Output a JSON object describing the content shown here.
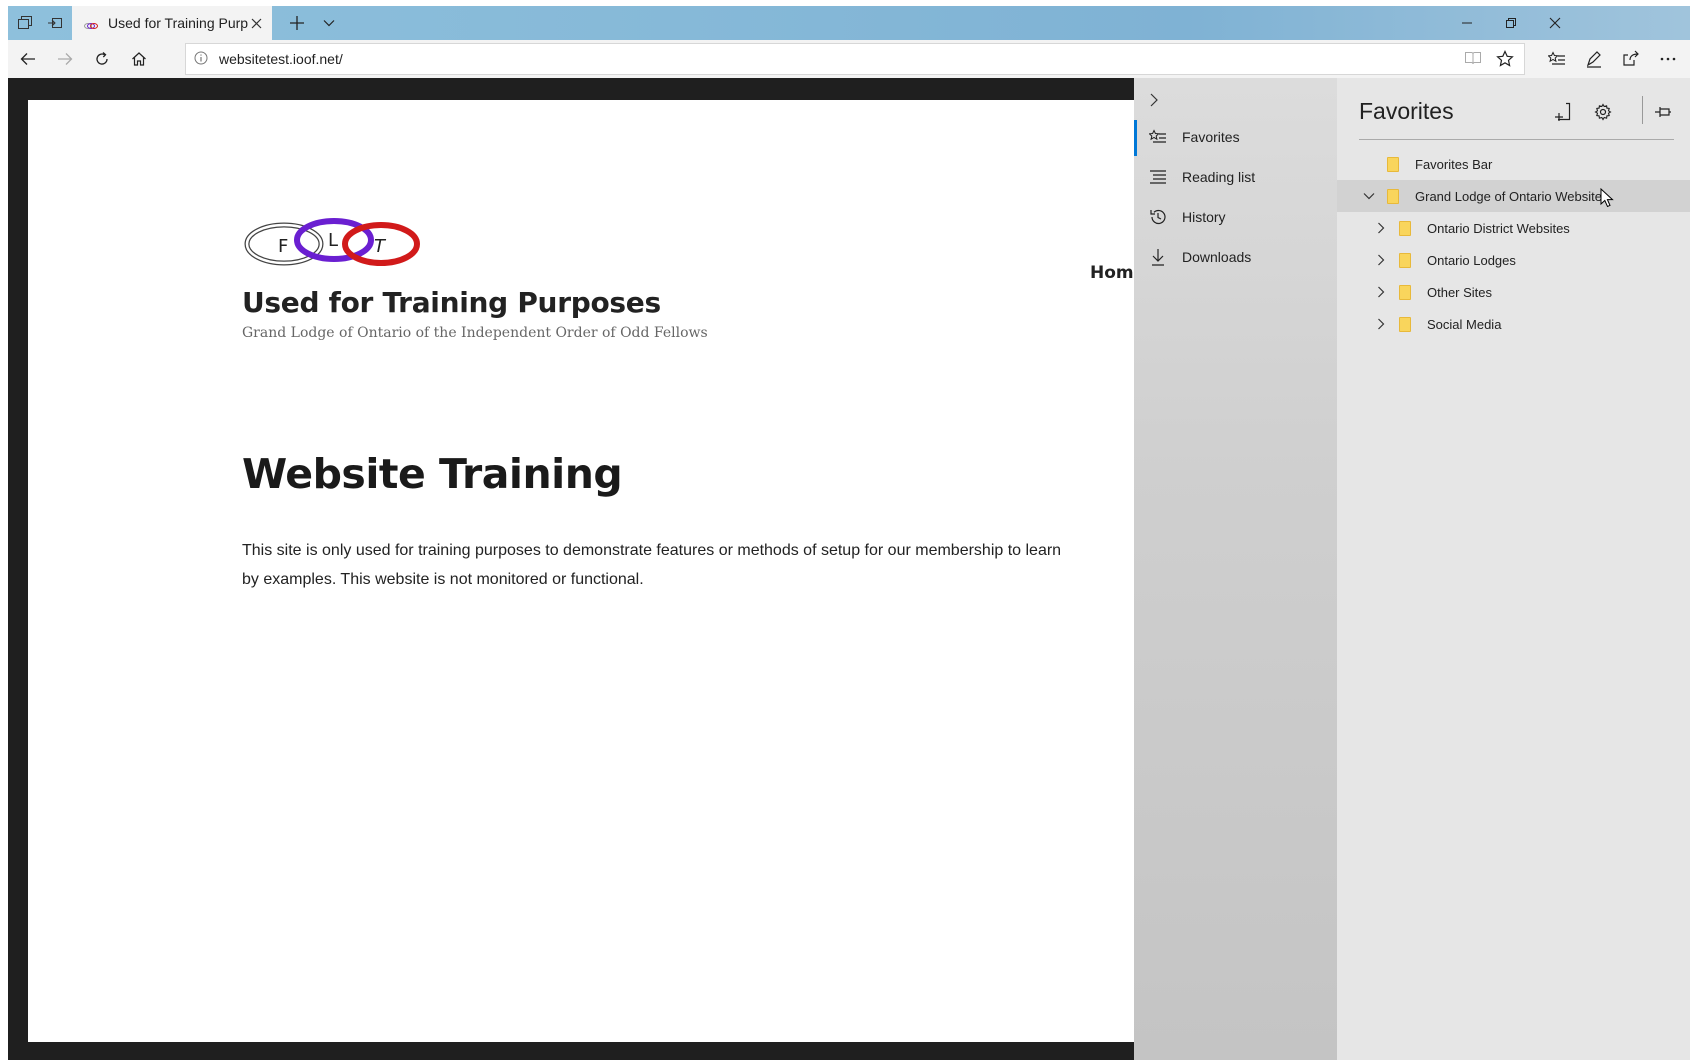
{
  "browser": {
    "tab_title": "Used for Training Purpo",
    "url": "websitetest.ioof.net/"
  },
  "page": {
    "nav_home": "Home",
    "logo_letters": [
      "F",
      "L",
      "T"
    ],
    "site_title": "Used for Training Purposes",
    "site_tagline": "Grand Lodge of Ontario of the Independent Order of Odd Fellows",
    "heading": "Website Training",
    "body": "This site is only used for training purposes to demonstrate features or methods of setup for our membership to learn by examples. This website is not monitored or functional."
  },
  "hub": {
    "nav": [
      {
        "label": "Favorites",
        "icon": "favorites-icon",
        "active": true
      },
      {
        "label": "Reading list",
        "icon": "reading-list-icon"
      },
      {
        "label": "History",
        "icon": "history-icon"
      },
      {
        "label": "Downloads",
        "icon": "downloads-icon"
      }
    ],
    "favorites": {
      "title": "Favorites",
      "items": [
        {
          "label": "Favorites Bar",
          "level": 0
        },
        {
          "label": "Grand Lodge of Ontario Websites",
          "level": 0,
          "expanded": true
        },
        {
          "label": "Ontario District Websites",
          "level": 1
        },
        {
          "label": "Ontario Lodges",
          "level": 1
        },
        {
          "label": "Other Sites",
          "level": 1
        },
        {
          "label": "Social Media",
          "level": 1
        }
      ]
    }
  },
  "colors": {
    "accent": "#0078d7",
    "folder": "#f9d55c",
    "logo_ring_l": "#6a1fd1",
    "logo_ring_t": "#d11a1a"
  }
}
